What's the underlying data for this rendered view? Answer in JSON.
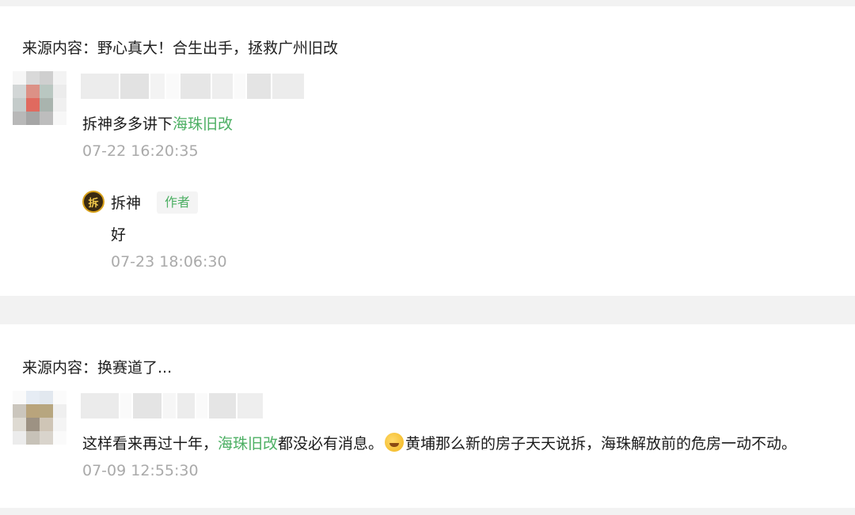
{
  "comments": [
    {
      "source_label": "来源内容：",
      "source_title": "野心真大！合生出手，拯救广州旧改",
      "text_before": "拆神多多讲下",
      "link_text": "海珠旧改",
      "text_after": "",
      "time": "07-22 16:20:35",
      "reply": {
        "author": "拆神",
        "avatar_glyph": "拆",
        "badge": "作者",
        "text": "好",
        "time": "07-23 18:06:30"
      }
    },
    {
      "source_label": "来源内容：",
      "source_title": "换赛道了...",
      "text_before": "这样看来再过十年，",
      "link_text": "海珠旧改",
      "text_middle": "都没必有消息。",
      "emoji": "laughing-crying-emoji",
      "text_after": "黄埔那么新的房子天天说拆，海珠解放前的危房一动不动。",
      "time": "07-09 12:55:30"
    }
  ],
  "colors": {
    "accent_green": "#4caf63",
    "timestamp_gray": "#aaaaaa",
    "page_bg": "#f2f2f2",
    "card_bg": "#ffffff"
  }
}
